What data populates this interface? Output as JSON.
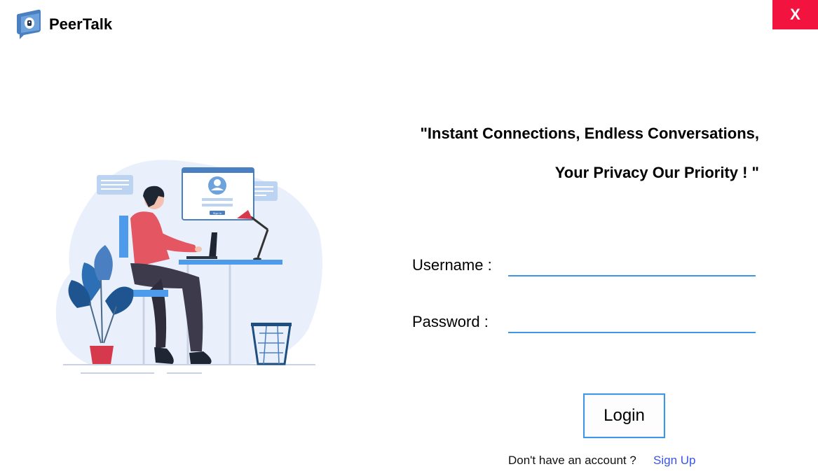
{
  "app": {
    "title": "PeerTalk",
    "logo_icon": "chat-bubble-lock-icon",
    "accent": "#3d97e6"
  },
  "window": {
    "close_label": "X",
    "close_color": "#f2143f"
  },
  "tagline": {
    "line1": "\"Instant Connections, Endless Conversations,",
    "line2": "Your Privacy Our Priority ! \""
  },
  "form": {
    "username_label": "Username :",
    "username_value": "",
    "password_label": "Password :",
    "password_value": "",
    "login_label": "Login"
  },
  "footer": {
    "prompt": "Don't have an account ?",
    "signup_label": "Sign Up",
    "signup_color": "#3b53e6"
  },
  "illustration": {
    "name": "person-working-at-desk-illustration",
    "login_card_button": "Sign In"
  }
}
